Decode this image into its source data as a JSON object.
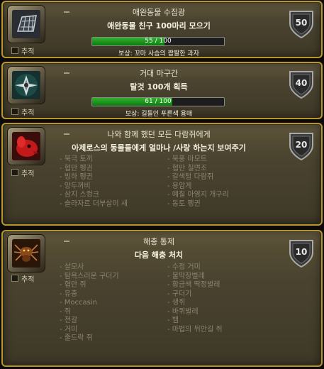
{
  "achievements": [
    {
      "title": "애완동물 수집광",
      "description": "애완동물 친구 100마리 모으기",
      "progress_text": "55 / 100",
      "progress": 0.55,
      "reward": "보상: 꼬마 사슴의 짭짤한 과자",
      "points": "50",
      "track_label": "추적",
      "icon": "cage-icon"
    },
    {
      "title": "거대 마구간",
      "description": "탈것 100개 획득",
      "progress_text": "61 / 100",
      "progress": 0.61,
      "reward": "보상: 길들인 푸른색 용매",
      "points": "40",
      "track_label": "추적",
      "icon": "stable-bird-icon"
    },
    {
      "title": "나와 함께 했던 모든 다람쥐에게",
      "description": "아제로스의 동물들에게 얼마나 /사랑 하는지 보여주기",
      "points": "20",
      "track_label": "추적",
      "icon": "red-critter-icon",
      "criteria_left": [
        "북극 토끼",
        "협만 펭귄",
        "빙하 펭귄",
        "양두꺼비",
        "삼지 스컹크",
        "슬라자르 더부살이 새"
      ],
      "criteria_right": [
        "북풍 마모트",
        "협만 칠면조",
        "갈색털 다람쥐",
        "용암게",
        "예칠 아영지 개구리",
        "동토 펭귄"
      ]
    },
    {
      "title": "해충 통제",
      "description": "다음 해충 처치",
      "points": "10",
      "track_label": "추적",
      "icon": "pest-spider-icon",
      "criteria_left": [
        "살모사",
        "탐욕스러운 구더기",
        "협만 쥐",
        "유충",
        "Moccasin",
        "쥐",
        "전갈",
        "거미",
        "줄드락 쥐"
      ],
      "criteria_right": [
        "수정 거미",
        "불막장벌레",
        "황금색 딱정벌레",
        "구더기",
        "생쥐",
        "바퀴벌레",
        "뱀",
        "마법의 뒤안길 쥐"
      ]
    }
  ]
}
